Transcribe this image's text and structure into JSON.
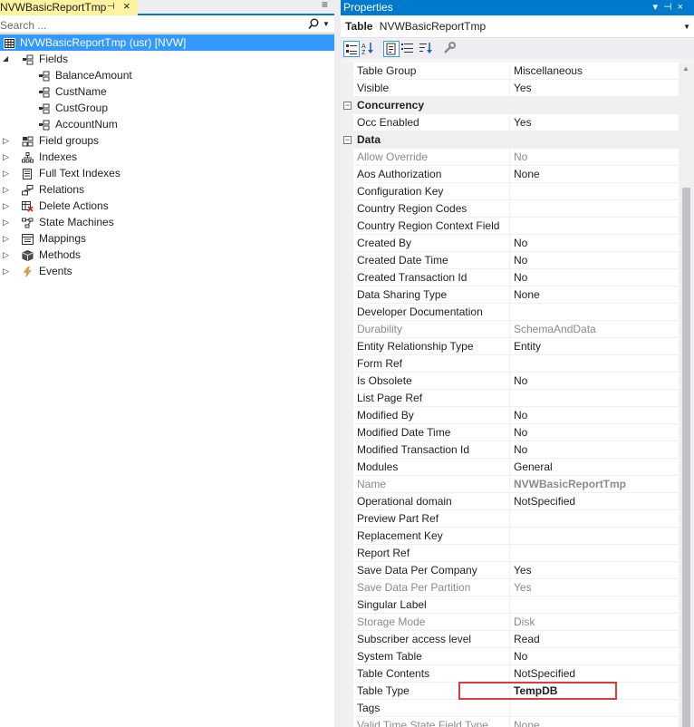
{
  "left": {
    "tab_title": "NVWBasicReportTmp",
    "search_placeholder": "Search ...",
    "tree": [
      {
        "label": "NVWBasicReportTmp (usr) [NVW]",
        "icon": "table-grid-icon",
        "level": 0,
        "selected": true
      },
      {
        "label": "Fields",
        "icon": "fields-icon",
        "level": 1,
        "expanded": true
      },
      {
        "label": "BalanceAmount",
        "icon": "field-icon",
        "level": 2
      },
      {
        "label": "CustName",
        "icon": "field-icon",
        "level": 2
      },
      {
        "label": "CustGroup",
        "icon": "field-icon",
        "level": 2
      },
      {
        "label": "AccountNum",
        "icon": "field-icon",
        "level": 2
      },
      {
        "label": "Field groups",
        "icon": "field-groups-icon",
        "level": 1
      },
      {
        "label": "Indexes",
        "icon": "indexes-icon",
        "level": 1
      },
      {
        "label": "Full Text Indexes",
        "icon": "full-text-indexes-icon",
        "level": 1
      },
      {
        "label": "Relations",
        "icon": "relations-icon",
        "level": 1
      },
      {
        "label": "Delete Actions",
        "icon": "delete-actions-icon",
        "level": 1
      },
      {
        "label": "State Machines",
        "icon": "state-machines-icon",
        "level": 1
      },
      {
        "label": "Mappings",
        "icon": "mappings-icon",
        "level": 1
      },
      {
        "label": "Methods",
        "icon": "methods-icon",
        "level": 1
      },
      {
        "label": "Events",
        "icon": "events-icon",
        "level": 1
      }
    ]
  },
  "properties": {
    "title": "Properties",
    "object_type": "Table",
    "object_name": "NVWBasicReportTmp",
    "rows": [
      {
        "name": "Table Group",
        "value": "Miscellaneous"
      },
      {
        "name": "Visible",
        "value": "Yes"
      },
      {
        "category": "Concurrency"
      },
      {
        "name": "Occ Enabled",
        "value": "Yes"
      },
      {
        "category": "Data"
      },
      {
        "name": "Allow Override",
        "value": "No",
        "dim": true
      },
      {
        "name": "Aos Authorization",
        "value": "None"
      },
      {
        "name": "Configuration Key",
        "value": ""
      },
      {
        "name": "Country Region Codes",
        "value": ""
      },
      {
        "name": "Country Region Context Field",
        "value": ""
      },
      {
        "name": "Created By",
        "value": "No"
      },
      {
        "name": "Created Date Time",
        "value": "No"
      },
      {
        "name": "Created Transaction Id",
        "value": "No"
      },
      {
        "name": "Data Sharing Type",
        "value": "None"
      },
      {
        "name": "Developer Documentation",
        "value": ""
      },
      {
        "name": "Durability",
        "value": "SchemaAndData",
        "dim": true
      },
      {
        "name": "Entity Relationship Type",
        "value": "Entity"
      },
      {
        "name": "Form Ref",
        "value": ""
      },
      {
        "name": "Is Obsolete",
        "value": "No"
      },
      {
        "name": "List Page Ref",
        "value": ""
      },
      {
        "name": "Modified By",
        "value": "No"
      },
      {
        "name": "Modified Date Time",
        "value": "No"
      },
      {
        "name": "Modified Transaction Id",
        "value": "No"
      },
      {
        "name": "Modules",
        "value": "General"
      },
      {
        "name": "Name",
        "value": "NVWBasicReportTmp",
        "dim": true,
        "bold": true
      },
      {
        "name": "Operational domain",
        "value": "NotSpecified"
      },
      {
        "name": "Preview Part Ref",
        "value": ""
      },
      {
        "name": "Replacement Key",
        "value": ""
      },
      {
        "name": "Report Ref",
        "value": ""
      },
      {
        "name": "Save Data Per Company",
        "value": "Yes"
      },
      {
        "name": "Save Data Per Partition",
        "value": "Yes",
        "dim": true
      },
      {
        "name": "Singular Label",
        "value": ""
      },
      {
        "name": "Storage Mode",
        "value": "Disk",
        "dim": true
      },
      {
        "name": "Subscriber access level",
        "value": "Read"
      },
      {
        "name": "System Table",
        "value": "No"
      },
      {
        "name": "Table Contents",
        "value": "NotSpecified"
      },
      {
        "name": "Table Type",
        "value": "TempDB",
        "bold": true
      },
      {
        "name": "Tags",
        "value": ""
      },
      {
        "name": "Valid Time State Field Type",
        "value": "None",
        "dim": true
      }
    ]
  },
  "colors": {
    "accent": "#007acc",
    "selection": "#3399ff",
    "tab_highlight": "#fff3a0",
    "annotation": "#e0393e"
  }
}
